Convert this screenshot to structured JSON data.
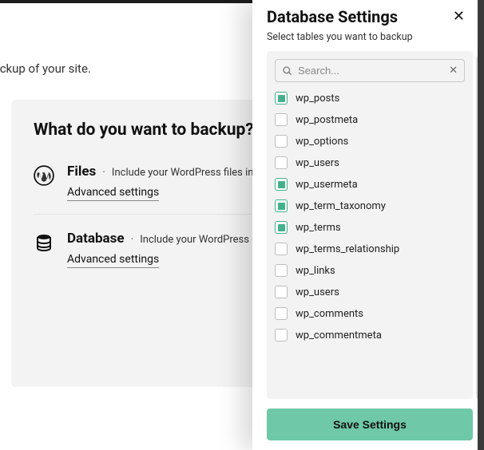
{
  "page": {
    "heading_partial": "up?",
    "subtitle_partial": "a new backup of your site."
  },
  "card": {
    "title": "What do you want to backup?",
    "items": [
      {
        "title": "Files",
        "desc": "Include your WordPress files in the backup",
        "advanced": "Advanced settings"
      },
      {
        "title": "Database",
        "desc": "Include your WordPress database",
        "advanced": "Advanced settings"
      }
    ]
  },
  "panel": {
    "title": "Database Settings",
    "subtitle": "Select tables you want to backup",
    "search_placeholder": "Search...",
    "save_label": "Save Settings",
    "tables": [
      {
        "name": "wp_posts",
        "checked": true
      },
      {
        "name": "wp_postmeta",
        "checked": false
      },
      {
        "name": "wp_options",
        "checked": false
      },
      {
        "name": "wp_users",
        "checked": false
      },
      {
        "name": "wp_usermeta",
        "checked": true
      },
      {
        "name": "wp_term_taxonomy",
        "checked": true
      },
      {
        "name": "wp_terms",
        "checked": true
      },
      {
        "name": "wp_terms_relationship",
        "checked": false
      },
      {
        "name": "wp_links",
        "checked": false
      },
      {
        "name": "wp_users",
        "checked": false
      },
      {
        "name": "wp_comments",
        "checked": false
      },
      {
        "name": "wp_commentmeta",
        "checked": false
      }
    ]
  }
}
